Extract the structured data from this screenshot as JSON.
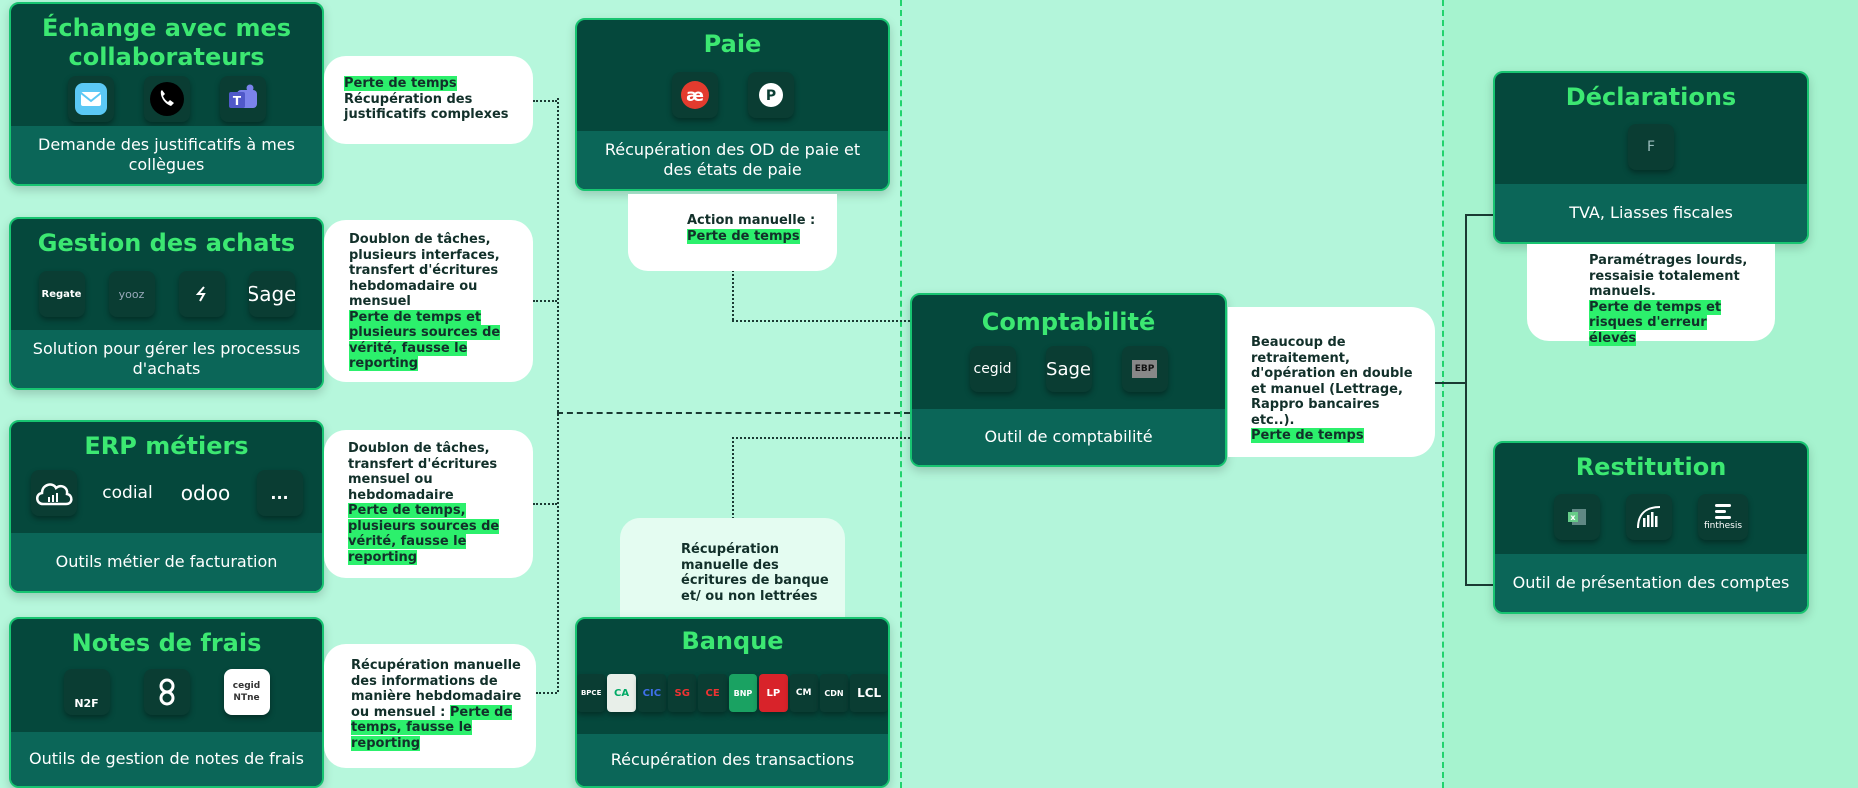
{
  "cards": {
    "echange": {
      "title": "Échange avec mes collaborateurs",
      "subtitle": "Demande des justificatifs à mes collègues",
      "icons": [
        "mail-icon",
        "phone-icon",
        "teams-icon"
      ]
    },
    "achats": {
      "title": "Gestion des achats",
      "subtitle": "Solution pour gérer les processus d'achats",
      "icons": [
        "Regate",
        "yooz",
        "libeo",
        "Sage"
      ]
    },
    "erp": {
      "title": "ERP métiers",
      "subtitle": "Outils métier de facturation",
      "icons": [
        "cloud-icon",
        "codial",
        "odoo",
        "..."
      ]
    },
    "frais": {
      "title": "Notes de frais",
      "subtitle": "Outils de gestion de notes de frais",
      "icons": [
        "N2F",
        "spendesk",
        "cegid NTne"
      ]
    },
    "paie": {
      "title": "Paie",
      "subtitle": "Récupération des OD de paie et des états de paie",
      "icons": [
        "æ",
        "P"
      ]
    },
    "banque": {
      "title": "Banque",
      "subtitle": "Récupération des transactions",
      "icons": [
        "BPCE",
        "CA",
        "CIC",
        "SG",
        "CE",
        "BNP",
        "LP",
        "CM",
        "CDN",
        "LCL"
      ]
    },
    "compta": {
      "title": "Comptabilité",
      "subtitle": "Outil de comptabilité",
      "icons": [
        "cegid",
        "Sage",
        "EBP"
      ]
    },
    "declarations": {
      "title": "Déclarations",
      "subtitle": "TVA, Liasses  fiscales",
      "icons": [
        "F"
      ]
    },
    "restitution": {
      "title": "Restitution",
      "subtitle": "Outil de présentation des comptes",
      "icons": [
        "excel-icon",
        "powerbi-icon",
        "finthesis"
      ]
    }
  },
  "notes": {
    "echange": {
      "highlight": "Perte de temps",
      "text": "Récupération des justificatifs complexes"
    },
    "achats": {
      "text": "Doublon de tâches, plusieurs interfaces, transfert d'écritures hebdomadaire ou mensuel",
      "highlight": "Perte de temps et plusieurs sources de vérité, fausse le reporting"
    },
    "erp": {
      "text": "Doublon de tâches, transfert d'écritures mensuel ou hebdomadaire",
      "highlight": "Perte de temps, plusieurs sources de vérité, fausse le reporting"
    },
    "frais": {
      "text": "Récupération manuelle des informations de manière hebdomadaire ou mensuel : ",
      "highlight": "Perte de temps, fausse le reporting"
    },
    "paie": {
      "text": "Action manuelle :",
      "highlight": "Perte de temps"
    },
    "banque": {
      "text": "Récupération manuelle des écritures de banque et/ ou non lettrées"
    },
    "compta": {
      "text": "Beaucoup de retraitement, d'opération en double et  manuel (Lettrage, Rappro bancaires etc..).",
      "highlight": "Perte de temps"
    },
    "declarations": {
      "text": "Paramétrages lourds, ressaisie totalement manuels.",
      "highlight": "Perte de temps et risques d'erreur élevés"
    }
  },
  "colors": {
    "background": "#b3f6da",
    "card": "#05483c",
    "card_footer": "#0b6658",
    "title": "#3ce872",
    "highlight": "#2cf06c",
    "dashed_line": "#22d36e"
  }
}
